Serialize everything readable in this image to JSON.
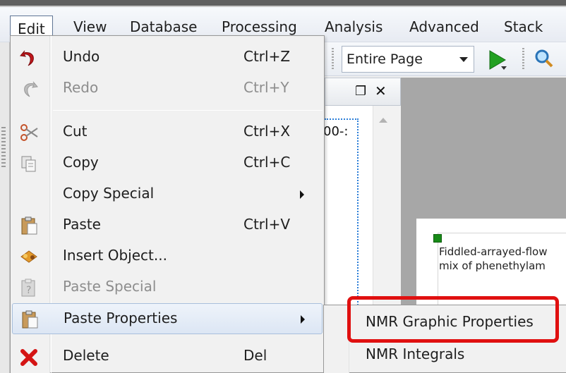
{
  "menubar": {
    "items": [
      "Edit",
      "View",
      "Database",
      "Processing",
      "Analysis",
      "Advanced",
      "Stack"
    ]
  },
  "toolbar": {
    "zoom_value": "Entire Page"
  },
  "document": {
    "fragment": "00-:",
    "page_lines": [
      "Fiddled-arrayed-flow",
      "mix of phenethylam"
    ]
  },
  "edit_menu": {
    "items": [
      {
        "label": "Undo",
        "shortcut": "Ctrl+Z",
        "icon": "undo-icon"
      },
      {
        "label": "Redo",
        "shortcut": "Ctrl+Y",
        "icon": "redo-icon"
      },
      {
        "label": "Cut",
        "shortcut": "Ctrl+X",
        "icon": "cut-icon"
      },
      {
        "label": "Copy",
        "shortcut": "Ctrl+C",
        "icon": "copy-icon"
      },
      {
        "label": "Copy Special",
        "shortcut": "",
        "icon": ""
      },
      {
        "label": "Paste",
        "shortcut": "Ctrl+V",
        "icon": "paste-icon"
      },
      {
        "label": "Insert Object...",
        "shortcut": "",
        "icon": "insert-object-icon"
      },
      {
        "label": "Paste Special",
        "shortcut": "",
        "icon": "paste-special-icon"
      },
      {
        "label": "Paste Properties",
        "shortcut": "",
        "icon": "paste-properties-icon"
      },
      {
        "label": "Delete",
        "shortcut": "Del",
        "icon": "delete-icon"
      }
    ]
  },
  "paste_properties_submenu": {
    "items": [
      "NMR Graphic Properties",
      "NMR Integrals"
    ]
  },
  "colors": {
    "highlight_box": "#e01010",
    "menu_background": "#f1f1f1",
    "canvas": "#a7a7a7",
    "play_green": "#22a022"
  }
}
